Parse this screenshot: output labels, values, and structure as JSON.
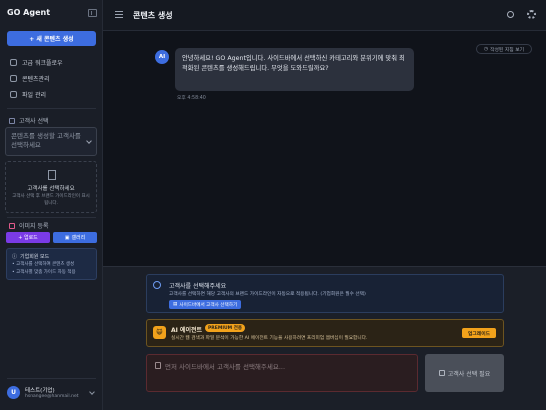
{
  "sidebar": {
    "brand": "GO Agent",
    "new_button": "+ 새 콘텐츠 생성",
    "nav": [
      {
        "label": "고급 워크플로우",
        "icon": "shield-icon"
      },
      {
        "label": "콘텐츠관리",
        "icon": "document-icon"
      },
      {
        "label": "파일 관리",
        "icon": "file-icon"
      }
    ],
    "client_section_title": "고객사 선택",
    "client_select_placeholder": "콘텐츠를 생성할 고객사를 선택하세요",
    "client_empty_title": "고객사를 선택하세요",
    "client_empty_desc": "고객사 선택 후 브랜드 가이드라인이 표시됩니다.",
    "image_section_title": "이미지 등록",
    "upload_label": "+ 업로드",
    "gallery_label": "갤러리",
    "mode_title": "기업회원 모드",
    "mode_lines": [
      "• 고객사를 선택하여 콘텐츠 생성",
      "• 고객사별 맞춤 가이드 자동 적용"
    ],
    "user_initial": "U",
    "user_name": "테스트(기업)",
    "user_email": "hsnangee@hanmail.net"
  },
  "header": {
    "title": "콘텐츠 생성"
  },
  "chat": {
    "save_label": "작성된 지침 보기",
    "ai_label": "AI",
    "message": "안녕하세요! GO Agent입니다. 사이드바에서 선택하신 카테고리와 분위기에 맞춰 최적화된 콘텐츠를 생성해드립니다. 무엇을 도와드릴까요?",
    "time": "오후 4:58:40"
  },
  "composer": {
    "notice_title": "고객사를 선택해주세요",
    "notice_desc": "고객사를 선택하면 해당 고객사의 브랜드 가이드라인이 자동으로 적용됩니다. (기업회원은 필수 선택)",
    "notice_button": "사이드바에서 고객사 선택하기",
    "premium_icon": "😺",
    "premium_title": "AI 에이전트",
    "premium_badge": "PREMIUM 전용",
    "premium_desc": "실시간 웹 검색과 파일 분석이 가능한 AI 에이전트 기능을 사용하려면 프리미엄 멤버십이 필요합니다.",
    "premium_button": "업그레이드",
    "input_placeholder": "먼저 사이드바에서 고객사를 선택해주세요...",
    "send_label": "고객사 선택 필요"
  }
}
